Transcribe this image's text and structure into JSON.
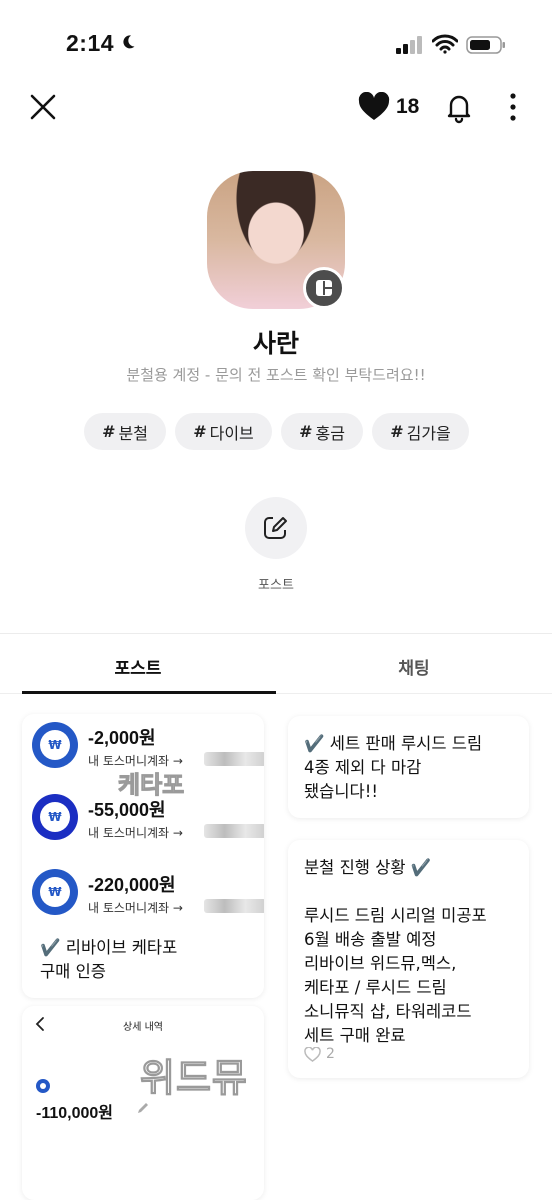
{
  "status_bar": {
    "time": "2:14"
  },
  "header": {
    "like_count": "18"
  },
  "profile": {
    "name": "사란",
    "description": "분철용 계정 - 문의 전 포스트 확인 부탁드려요!!",
    "tags": [
      "분철",
      "다이브",
      "홍금",
      "김가을"
    ],
    "hash": "#"
  },
  "action": {
    "post_label": "포스트"
  },
  "tabs": [
    {
      "label": "포스트"
    },
    {
      "label": "채팅"
    }
  ],
  "feed": {
    "left_card": {
      "transactions": [
        {
          "amount": "-2,000원",
          "account": "내 토스머니계좌 →"
        },
        {
          "amount": "-55,000원",
          "account": "내 토스머니계좌 →"
        },
        {
          "amount": "-220,000원",
          "account": "내 토스머니계좌 →"
        }
      ],
      "watermark": "케타포",
      "text": "✔️ 리바이브 케타포\n구매 인증"
    },
    "left_card2": {
      "title": "상세 내역",
      "amount": "-110,000원",
      "watermark": "위드뮤"
    },
    "right_card1": {
      "text": "✔️ 세트 판매 루시드 드림\n4종 제외 다 마감\n됐습니다!!"
    },
    "right_card2": {
      "text": "분철 진행 상황 ✔️\n\n루시드 드림 시리얼 미공포\n6월 배송 출발 예정\n리바이브 위드뮤,멕스,\n케타포 / 루시드 드림\n소니뮤직 샵, 타워레코드\n세트 구매 완료",
      "likes": "2"
    }
  },
  "colors": {
    "toss_blue": "#2458c6",
    "accent_dark": "#111111"
  }
}
